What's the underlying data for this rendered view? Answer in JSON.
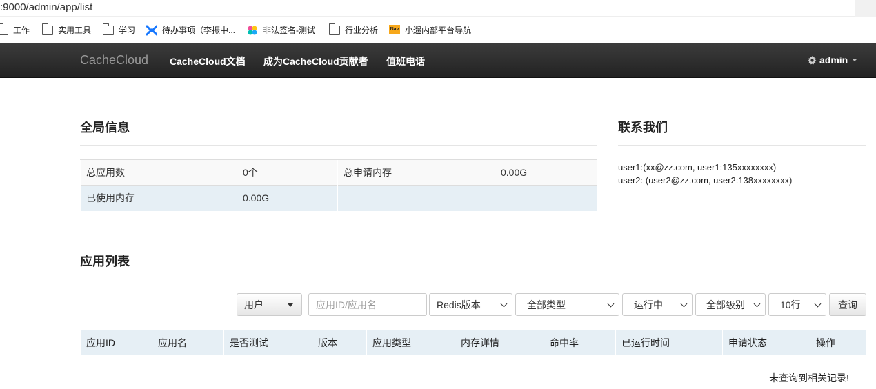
{
  "browser": {
    "url": ":9000/admin/app/list",
    "bookmarks": [
      {
        "label": "工作",
        "icon": "folder-icon"
      },
      {
        "label": "实用工具",
        "icon": "folder-icon"
      },
      {
        "label": "学习",
        "icon": "folder-icon"
      },
      {
        "label": "待办事项（李振中...",
        "icon": "task-app-icon"
      },
      {
        "label": "非法签名-测试",
        "icon": "kibana-icon"
      },
      {
        "label": "行业分析",
        "icon": "folder-icon"
      },
      {
        "label": "小遛内部平台导航",
        "icon": "nav-icon",
        "icon_text": "Nav"
      }
    ]
  },
  "navbar": {
    "brand": "CacheCloud",
    "links": [
      "CacheCloud文档",
      "成为CacheCloud贡献者",
      "值班电话"
    ],
    "user": "admin",
    "user_icon": "gear-icon"
  },
  "global_info": {
    "title": "全局信息",
    "rows": [
      [
        "总应用数",
        "0个",
        "总申请内存",
        "0.00G"
      ],
      [
        "已使用内存",
        "0.00G",
        "",
        ""
      ]
    ]
  },
  "contact": {
    "title": "联系我们",
    "lines": [
      "user1:(xx@zz.com, user1:135xxxxxxxx)",
      "user2: (user2@zz.com, user2:138xxxxxxxx)"
    ]
  },
  "app_list": {
    "title": "应用列表",
    "filters": {
      "user_button": "用户",
      "search_placeholder": "应用ID/应用名",
      "redis_version": "Redis版本",
      "type": "全部类型",
      "status": "运行中",
      "level": "全部级别",
      "page_size": "10行",
      "query_button": "查询"
    },
    "columns": [
      "应用ID",
      "应用名",
      "是否测试",
      "版本",
      "应用类型",
      "内存详情",
      "命中率",
      "已运行时间",
      "申请状态",
      "操作"
    ],
    "empty_message": "未查询到相关记录!"
  }
}
